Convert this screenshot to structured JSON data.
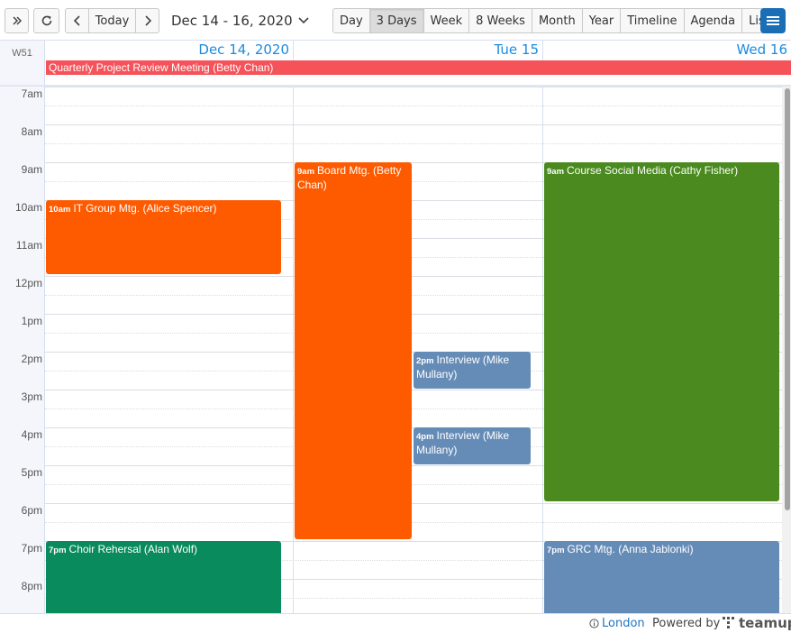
{
  "toolbar": {
    "today_label": "Today",
    "date_range": "Dec 14 - 16, 2020",
    "views": [
      "Day",
      "3 Days",
      "Week",
      "8 Weeks",
      "Month",
      "Year",
      "Timeline",
      "Agenda",
      "List"
    ],
    "active_view": "3 Days"
  },
  "calendar": {
    "week_label": "W51",
    "days": [
      "Dec 14, 2020",
      "Tue 15",
      "Wed 16"
    ],
    "all_day_event": "Quarterly Project Review Meeting (Betty Chan)",
    "hours": [
      "7am",
      "8am",
      "9am",
      "10am",
      "11am",
      "12pm",
      "1pm",
      "2pm",
      "3pm",
      "4pm",
      "5pm",
      "6pm",
      "7pm",
      "8pm"
    ],
    "events": [
      {
        "time": "10am",
        "title": "IT Group Mtg. (Alice Spencer)",
        "color": "#fe5a00"
      },
      {
        "time": "9am",
        "title": "Board Mtg. (Betty Chan)",
        "color": "#fe5a00"
      },
      {
        "time": "2pm",
        "title": "Interview (Mike Mullany)",
        "color": "#658cb7"
      },
      {
        "time": "4pm",
        "title": "Interview (Mike Mullany)",
        "color": "#658cb7"
      },
      {
        "time": "9am",
        "title": "Course Social Media (Cathy Fisher)",
        "color": "#4a8a1f"
      },
      {
        "time": "7pm",
        "title": "Choir Rehersal (Alan Wolf)",
        "color": "#098b5d"
      },
      {
        "time": "7pm",
        "title": "GRC Mtg. (Anna Jablonki)",
        "color": "#658cb7"
      }
    ]
  },
  "footer": {
    "timezone": "London",
    "powered_by": "Powered by",
    "brand": "teamup"
  },
  "colors": {
    "accent": "#1a8be0",
    "allday_event": "#f5525a",
    "menu_button": "#1a6eb5"
  }
}
